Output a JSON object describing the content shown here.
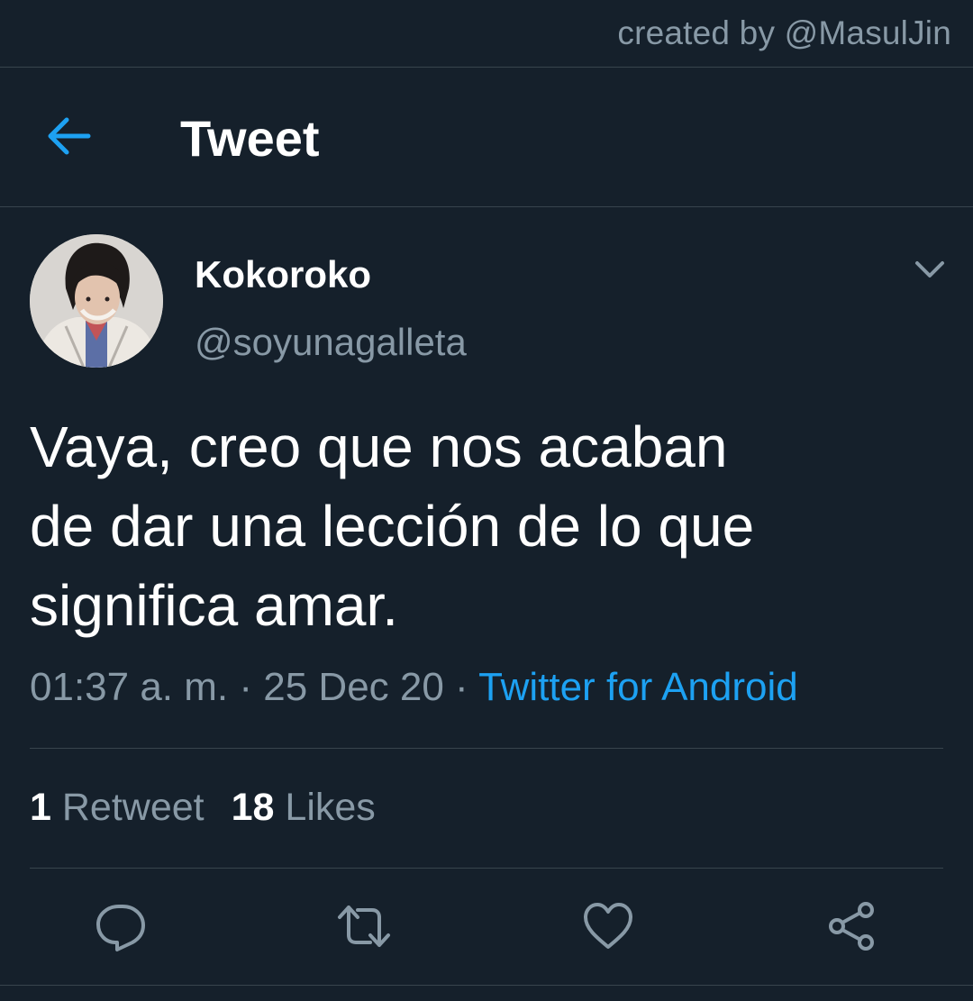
{
  "watermark": "created by @MasulJin",
  "header": {
    "title": "Tweet"
  },
  "author": {
    "display_name": "Kokoroko",
    "handle": "@soyunagalleta"
  },
  "tweet": {
    "text_lines": [
      "Vaya, creo que nos acaban",
      "de dar una lección de lo que",
      "significa amar."
    ],
    "time": "01:37 a. m.",
    "sep1": " · ",
    "date": "25 Dec 20",
    "sep2": " · ",
    "source": "Twitter for Android"
  },
  "stats": {
    "retweets_count": "1",
    "retweets_label": "Retweet",
    "likes_count": "18",
    "likes_label": "Likes"
  },
  "icons": {
    "back": "arrow-left-icon",
    "caret": "chevron-down-icon",
    "reply": "reply-icon",
    "retweet": "retweet-icon",
    "like": "heart-icon",
    "share": "share-icon"
  },
  "colors": {
    "background": "#15202b",
    "divider": "#38444d",
    "primary_text": "#ffffff",
    "secondary_text": "#8899a6",
    "accent": "#1da1f2"
  }
}
